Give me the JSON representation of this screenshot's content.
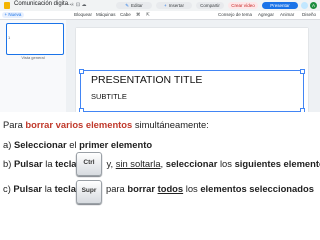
{
  "app": {
    "doc_title": "Comunicación digita...",
    "top_icons": "☆ ⊡ ☁",
    "edit_label": "Editar",
    "insert_label": "Insertar",
    "share_label": "Compartir",
    "video_label": "Crear vídeo",
    "present_label": "Presentar",
    "avatar_initial": "A"
  },
  "toolbar": {
    "new_label": "+ Nueva",
    "items": [
      "Bloquear",
      "Máquinas",
      "Cabe",
      "⌘",
      "⇱",
      "Consejo de tema",
      "Agregar",
      "Animar",
      "Diseño"
    ]
  },
  "filmstrip": {
    "slide_number": "1",
    "caption": "Vista general"
  },
  "slide": {
    "title": "PRESENTATION TITLE",
    "subtitle": "SUBTITLE"
  },
  "instructions": {
    "intro": {
      "p1": "Para ",
      "p2": "borrar varios elementos",
      "p3": " simultáneamente:"
    },
    "step_a": {
      "p1": "a) ",
      "p2": "Seleccionar",
      "p3": " el ",
      "p4": "primer elemento"
    },
    "step_b": {
      "p1": "b) ",
      "p2": "Pulsar",
      "p3": " la ",
      "p4": "tecla",
      "p5": "y, ",
      "p6": "sin soltarla",
      "p7": ", ",
      "p8": "seleccionar",
      "p9": " los ",
      "p10": "siguientes elementos"
    },
    "step_c": {
      "p1": "c) ",
      "p2": "Pulsar",
      "p3": " la ",
      "p4": "tecla",
      "p5": "para ",
      "p6": "borrar",
      "p7": " ",
      "p8": "todos",
      "p9": " los ",
      "p10": "elementos seleccionados"
    },
    "key_ctrl": "Ctrl",
    "key_supr": "Supr"
  },
  "colors": {
    "accent": "#1a73e8",
    "emphasis": "#c0392b"
  }
}
